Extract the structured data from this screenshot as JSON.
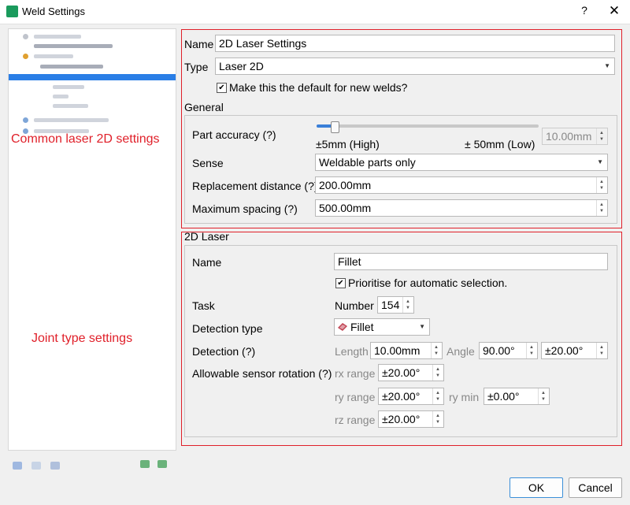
{
  "window": {
    "title": "Weld Settings",
    "help": "?",
    "close": "✕"
  },
  "annotations": {
    "common": "Common laser 2D settings",
    "joint": "Joint type settings"
  },
  "top": {
    "name_label": "Name",
    "name_value": "2D Laser Settings",
    "type_label": "Type",
    "type_value": "Laser 2D",
    "default_label": "Make this the default for new welds?",
    "default_checked": true
  },
  "general": {
    "title": "General",
    "accuracy_label": "Part accuracy (?)",
    "accuracy_low": "±5mm (High)",
    "accuracy_high": "± 50mm (Low)",
    "accuracy_value": "10.00mm",
    "accuracy_fraction": 0.08,
    "sense_label": "Sense",
    "sense_value": "Weldable parts only",
    "replacement_label": "Replacement distance (?)",
    "replacement_value": "200.00mm",
    "spacing_label": "Maximum spacing (?)",
    "spacing_value": "500.00mm"
  },
  "laser": {
    "title": "2D Laser",
    "name_label": "Name",
    "name_value": "Fillet",
    "prioritise_label": "Prioritise for automatic selection.",
    "prioritise_checked": true,
    "task_label": "Task",
    "number_label": "Number",
    "number_value": "154",
    "detection_type_label": "Detection type",
    "detection_type_value": "Fillet",
    "detection_label": "Detection (?)",
    "length_label": "Length",
    "length_value": "10.00mm",
    "angle_label": "Angle",
    "angle_value": "90.00°",
    "angle_tol": "±20.00°",
    "rotation_label": "Allowable sensor rotation (?)",
    "rx_label": "rx range",
    "rx_value": "±20.00°",
    "ry_label": "ry range",
    "ry_value": "±20.00°",
    "rymin_label": "ry min",
    "rymin_value": "±0.00°",
    "rz_label": "rz range",
    "rz_value": "±20.00°"
  },
  "buttons": {
    "ok": "OK",
    "cancel": "Cancel"
  }
}
